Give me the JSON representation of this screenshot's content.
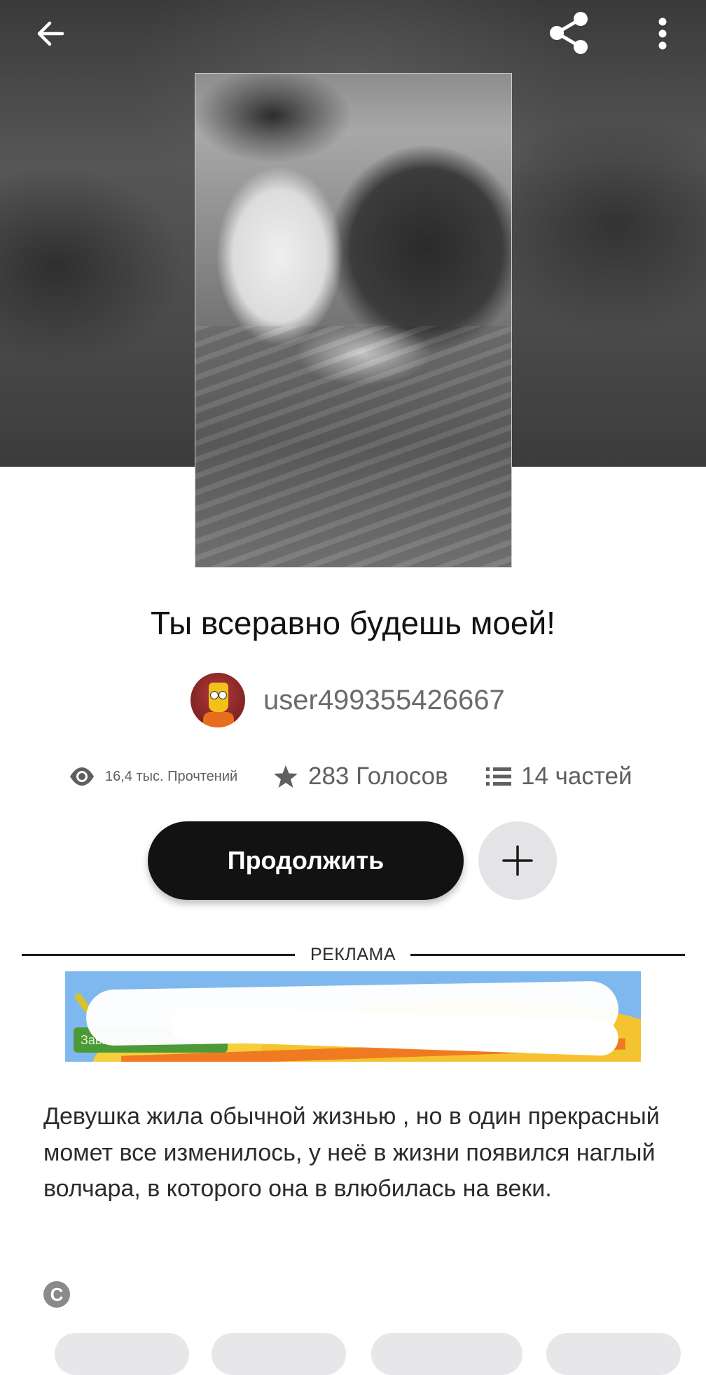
{
  "toolbar": {
    "back_icon": "arrow-left-icon",
    "share_icon": "share-icon",
    "more_icon": "more-vertical-icon"
  },
  "story": {
    "title": "Ты всеравно будешь моей!",
    "author": "user499355426667",
    "description": "Девушка жила обычной жизнью , но в один прекрасный момет все изменилось,  у неё в жизни появился наглый волчара, в которого она в влюбилась на веки."
  },
  "stats": {
    "reads": "16,4 тыс. Прочтений",
    "votes": "283 Голосов",
    "parts": "14 частей"
  },
  "actions": {
    "continue_label": "Продолжить",
    "add_icon": "plus-icon"
  },
  "ad": {
    "label": "РЕКЛАМА",
    "cta_fragment": "Заван"
  },
  "copyright_icon": "copyright-icon",
  "colors": {
    "primary_button": "#121212",
    "secondary_button": "#e4e3e5",
    "muted_text": "#6b6b6b"
  }
}
